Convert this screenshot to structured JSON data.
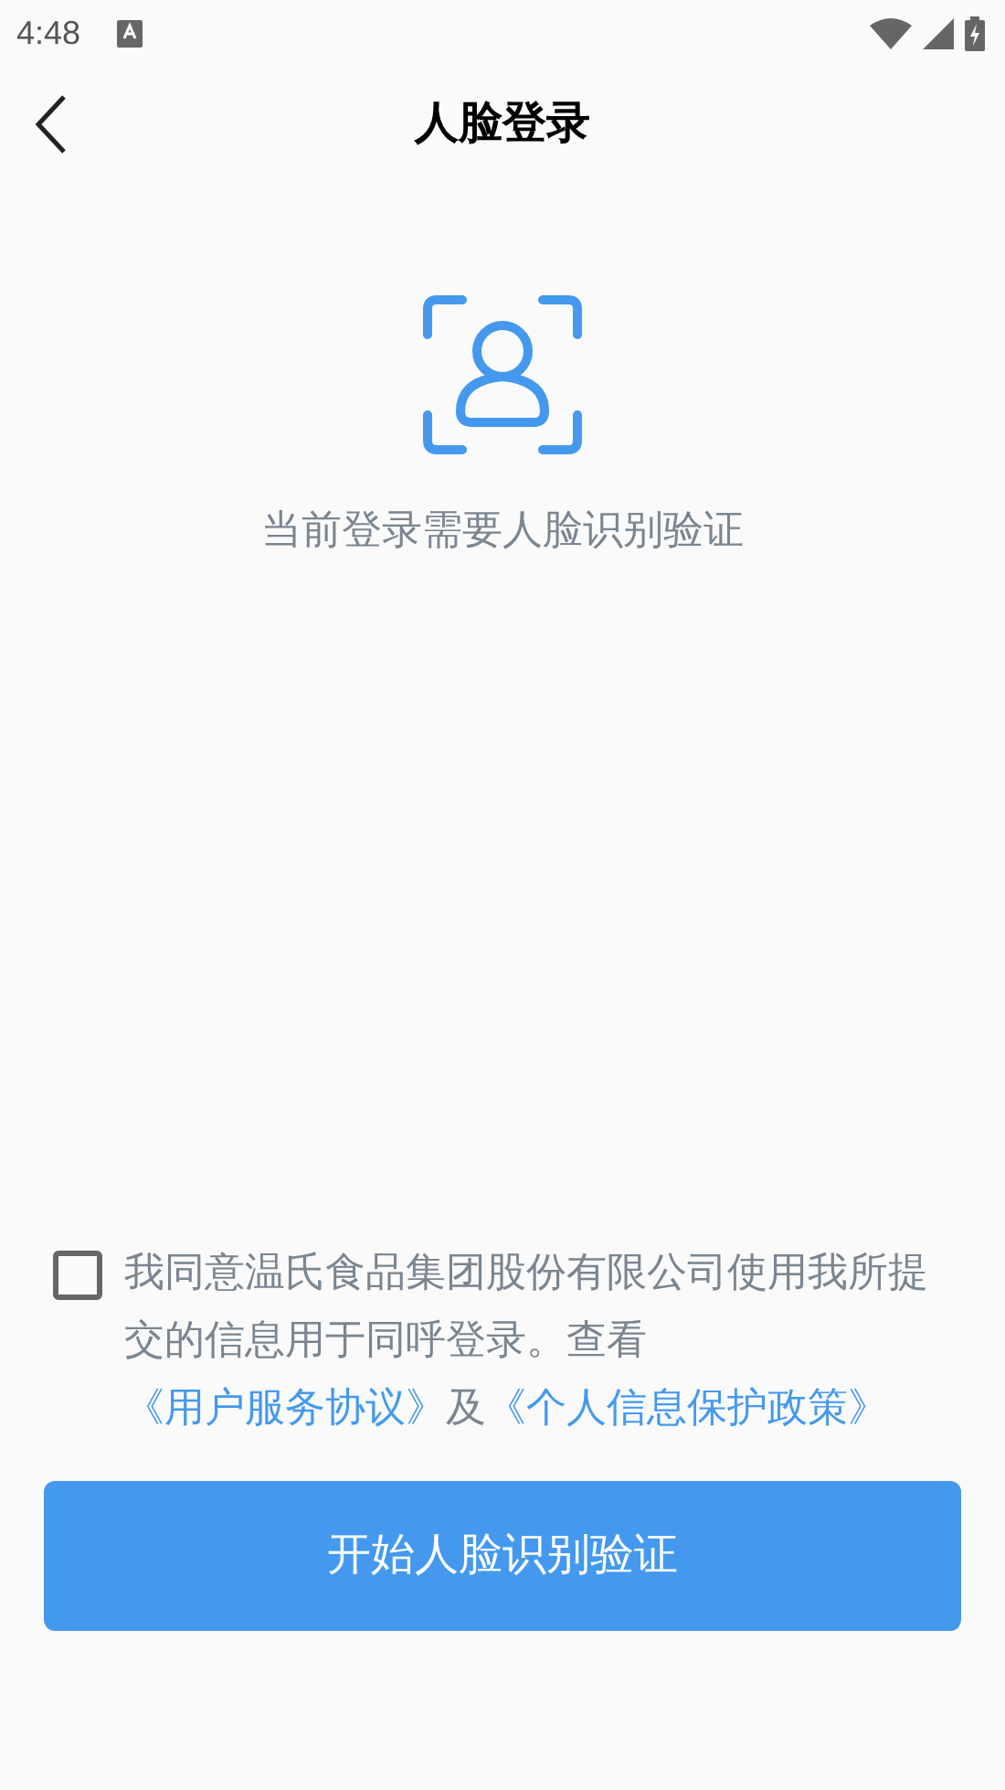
{
  "status_bar": {
    "time": "4:48"
  },
  "header": {
    "title": "人脸登录"
  },
  "prompt": "当前登录需要人脸识别验证",
  "agreement": {
    "checked": false,
    "parts": [
      {
        "kind": "text",
        "text": "我同意温氏食品集团股份有限公司使用我所提交的信息用于同呼登录。查看"
      },
      {
        "kind": "link",
        "text": "《用户服务协议》"
      },
      {
        "kind": "text",
        "text": "及"
      },
      {
        "kind": "link",
        "text": "《个人信息保护政策》"
      }
    ]
  },
  "start_button": "开始人脸识别验证"
}
